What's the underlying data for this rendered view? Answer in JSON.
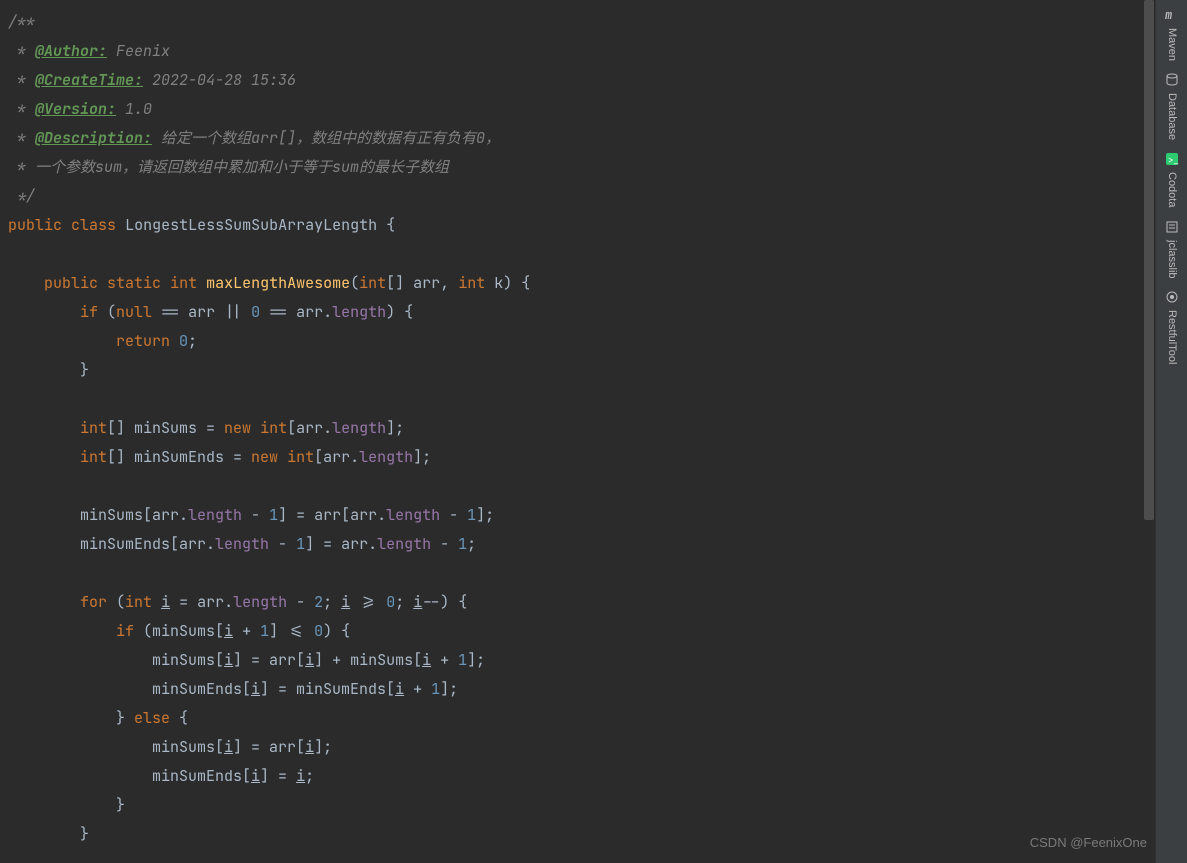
{
  "code": {
    "doc": {
      "open": "/**",
      "author_label": "@Author:",
      "author_val": " Feenix",
      "createtime_label": "@CreateTime:",
      "createtime_val": " 2022-04-28 15:36",
      "version_label": "@Version:",
      "version_val": " 1.0",
      "description_label": "@Description:",
      "description_val": " 给定一个数组arr[]，数组中的数据有正有负有0，",
      "description_line2": " * 一个参数sum，请返回数组中累加和小于等于sum的最长子数组",
      "close": " */"
    },
    "class_decl": {
      "public": "public",
      "class": "class",
      "name": "LongestLessSumSubArrayLength",
      "brace": " {"
    },
    "method": {
      "public": "public",
      "static": "static",
      "int": "int",
      "name": "maxLengthAwesome",
      "params_open": "(",
      "int_arr": "int",
      "brackets": "[] ",
      "arr": "arr",
      "comma": ", ",
      "int2": "int",
      "k": " k",
      "params_close": ") {"
    },
    "lines": {
      "l1_if": "if",
      "l1_open": " (",
      "l1_null": "null",
      "l1_eq": " == arr || ",
      "l1_zero": "0",
      "l1_eq2": " == arr.",
      "l1_length": "length",
      "l1_close": ") {",
      "l2_return": "return",
      "l2_zero": " 0",
      "l2_semi": ";",
      "l3_close": "}",
      "l4_int": "int",
      "l4_br": "[] minSums = ",
      "l4_new": "new",
      "l4_int2": " int",
      "l4_br2": "[arr.",
      "l4_length": "length",
      "l4_close": "];",
      "l5_int": "int",
      "l5_br": "[] minSumEnds = ",
      "l5_new": "new",
      "l5_int2": " int",
      "l5_br2": "[arr.",
      "l5_length": "length",
      "l5_close": "];",
      "l6_a": "minSums[arr.",
      "l6_length": "length",
      "l6_b": " - ",
      "l6_one": "1",
      "l6_c": "] = arr[arr.",
      "l6_length2": "length",
      "l6_d": " - ",
      "l6_one2": "1",
      "l6_e": "];",
      "l7_a": "minSumEnds[arr.",
      "l7_length": "length",
      "l7_b": " - ",
      "l7_one": "1",
      "l7_c": "] = arr.",
      "l7_length2": "length",
      "l7_d": " - ",
      "l7_one2": "1",
      "l7_e": ";",
      "l8_for": "for",
      "l8_a": " (",
      "l8_int": "int",
      "l8_b": " ",
      "l8_i": "i",
      "l8_c": " = arr.",
      "l8_length": "length",
      "l8_d": " - ",
      "l8_two": "2",
      "l8_e": "; ",
      "l8_i2": "i",
      "l8_f": " >= ",
      "l8_zero": "0",
      "l8_g": "; ",
      "l8_i3": "i",
      "l8_h": "--) {",
      "l9_if": "if",
      "l9_a": " (minSums[",
      "l9_i": "i",
      "l9_b": " + ",
      "l9_one": "1",
      "l9_c": "] <= ",
      "l9_zero": "0",
      "l9_d": ") {",
      "l10_a": "minSums[",
      "l10_i": "i",
      "l10_b": "] = arr[",
      "l10_i2": "i",
      "l10_c": "] + minSums[",
      "l10_i3": "i",
      "l10_d": " + ",
      "l10_one": "1",
      "l10_e": "];",
      "l11_a": "minSumEnds[",
      "l11_i": "i",
      "l11_b": "] = minSumEnds[",
      "l11_i2": "i",
      "l11_c": " + ",
      "l11_one": "1",
      "l11_d": "];",
      "l12_a": "} ",
      "l12_else": "else",
      "l12_b": " {",
      "l13_a": "minSums[",
      "l13_i": "i",
      "l13_b": "] = arr[",
      "l13_i2": "i",
      "l13_c": "];",
      "l14_a": "minSumEnds[",
      "l14_i": "i",
      "l14_b": "] = ",
      "l14_i2": "i",
      "l14_c": ";",
      "l15": "}",
      "l16": "}"
    }
  },
  "sidebar": {
    "items": [
      {
        "label": "Maven",
        "icon": "maven-icon",
        "color": "#bbbbbb"
      },
      {
        "label": "Database",
        "icon": "database-icon",
        "color": "#bbbbbb"
      },
      {
        "label": "Codota",
        "icon": "codota-icon",
        "color": "#2ecc71"
      },
      {
        "label": "jclasslib",
        "icon": "jclasslib-icon",
        "color": "#bbbbbb"
      },
      {
        "label": "RestfulTool",
        "icon": "restfultool-icon",
        "color": "#bbbbbb"
      }
    ]
  },
  "watermark": "CSDN @FeenixOne"
}
